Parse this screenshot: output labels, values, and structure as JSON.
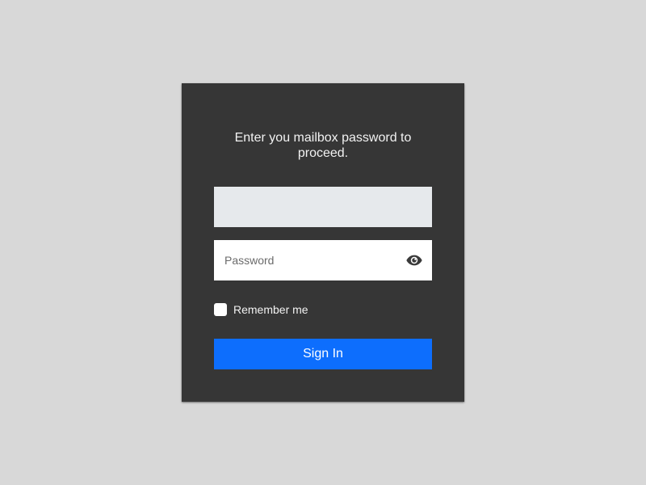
{
  "login": {
    "prompt": "Enter you mailbox password to proceed.",
    "email": {
      "value": "",
      "placeholder": ""
    },
    "password": {
      "value": "",
      "placeholder": "Password",
      "toggle_icon": "eye-icon"
    },
    "remember_label": "Remember me",
    "remember_checked": false,
    "signin_label": "Sign In"
  },
  "colors": {
    "background": "#d8d8d8",
    "card": "#363636",
    "accent": "#0d6efd",
    "email_field": "#e6e9ec"
  }
}
